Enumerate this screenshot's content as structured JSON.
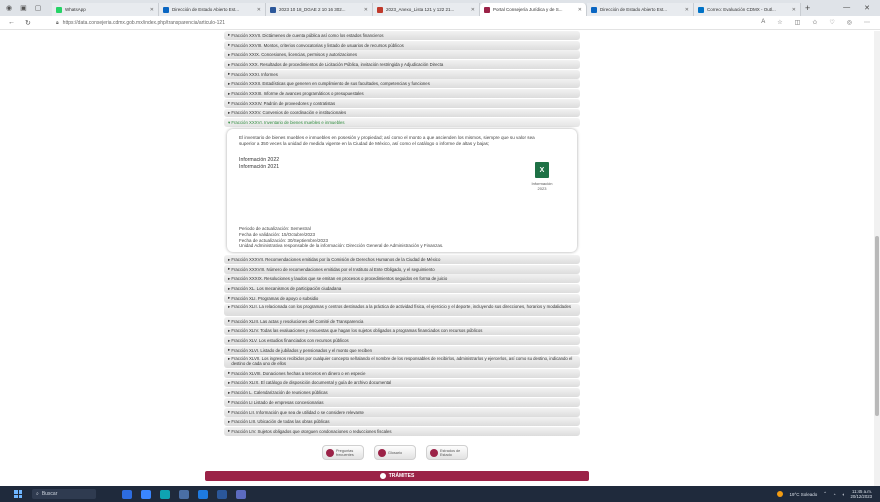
{
  "browser": {
    "tabs": [
      {
        "label": "WhatsApp",
        "color": "#25d366",
        "active": false
      },
      {
        "label": "Dirección de Estado Abierto Est...",
        "color": "#0a66c2",
        "active": false
      },
      {
        "label": "2023 10 18_DGAE 2 10 16 302...",
        "color": "#2b579a",
        "active": false
      },
      {
        "label": "2023_Anexo_Lista 121 y 122 21...",
        "color": "#c0392b",
        "active": false
      },
      {
        "label": "Portal Consejería Jurídica y de S...",
        "color": "#9b2247",
        "active": true
      },
      {
        "label": "Dirección de Estado Abierto Est...",
        "color": "#0a66c2",
        "active": false
      },
      {
        "label": "Correo: Evaluación CDMX - Outl...",
        "color": "#0072c6",
        "active": false
      }
    ],
    "new_tab": "+",
    "url": "https://data.consejeria.cdmx.gob.mx/index.php/transparencia/articulo-121"
  },
  "fractions_top": [
    "Fracción XXVII. Dictámenes de cuenta pública así como los estados financieros",
    "Fracción XXVIII. Montos, criterios convocatorias y listado de usuarios de recursos públicos",
    "Fracción XXIX. Concesiones, licencias, permisos y autorizaciones",
    "Fracción XXX. Resultados de procedimientos de Licitación Pública, invitación restringida y Adjudicación Directa",
    "Fracción XXXI. Informes",
    "Fracción XXXII. Estadísticas que generen en cumplimiento de sus facultades, competencias y funciones",
    "Fracción XXXIII. Informe de avances programáticos o presupuestales",
    "Fracción XXXIV. Padrón de proveedores y contratistas",
    "Fracción XXXV. Convenios de coordinación e institucionales"
  ],
  "open_fraction": {
    "title": "Fracción XXXVI. Inventario de bienes muebles e inmuebles",
    "intro": "El inventario de bienes muebles e inmuebles en posesión y propiedad; así como el monto a que ascienden los mismos, siempre que su valor sea superior a 350 veces la unidad de medida vigente en la Ciudad de México, así como el catálogo o informe de altas y bajas;",
    "info_2022": "Información 2022",
    "info_2021": "Información 2021",
    "excel_caption": "Información 2023",
    "periodo": "Periodo de actualización: Semestral",
    "validacion": "Fecha de validación: 15/Octubre/2023",
    "actualizacion": "Fecha de actualización: 30/Septiembre/2023",
    "unidad": "Unidad Administrativa responsable de la información: Dirección General de Administración y Finanzas."
  },
  "fractions_bottom": [
    {
      "text": "Fracción XXXVII. Recomendaciones emitidas por la Comisión de Derechos Humanos de la Ciudad de México",
      "tall": false
    },
    {
      "text": "Fracción XXXVIII. Número de recomendaciones emitidas por el Instituto al Ente Obligado, y el seguimiento",
      "tall": false
    },
    {
      "text": "Fracción XXXIX. Resoluciones y laudos que se emitan en procesos o procedimientos seguidos en forma de juicio",
      "tall": false
    },
    {
      "text": "Fracción XL. Los mecanismos de participación ciudadana",
      "tall": false
    },
    {
      "text": "Fracción XLI. Programas de apoyo o subsidio",
      "tall": false
    },
    {
      "text": "Fracción XLII. La relacionada con los programas y centros destinados a la práctica de actividad física, el ejercicio y el deporte, incluyendo sus direcciones, horarios y modalidades",
      "tall": true
    },
    {
      "text": "Fracción XLIII. Las actas y resoluciones del Comité de Transparencia",
      "tall": false
    },
    {
      "text": "Fracción XLIV. Todas las evaluaciones y encuestas que hagan los sujetos obligados a programas financiados con recursos públicos",
      "tall": false
    },
    {
      "text": "Fracción XLV. Los estudios financiados con recursos públicos",
      "tall": false
    },
    {
      "text": "Fracción XLVI. Listado de jubilados y pensionados y el monto que reciben",
      "tall": false
    },
    {
      "text": "Fracción XLVII. Los ingresos recibidos por cualquier concepto señalando el nombre de los responsables de recibirlos, administrarlos y ejercerlos, así como su destino, indicando el destino de cada uno de ellos",
      "tall": true
    },
    {
      "text": "Fracción XLVIII. Donaciones hechas a terceros en dinero o en especie",
      "tall": false
    },
    {
      "text": "Fracción XLIX. El catálogo de disposición documental y guía de archivo documental",
      "tall": false
    },
    {
      "text": "Fracción L. Calendarización de reuniones públicas",
      "tall": false
    },
    {
      "text": "Fracción LI Listado de empresas concesionarias",
      "tall": false
    },
    {
      "text": "Fracción LII. Información que sea de utilidad o se considere relevante",
      "tall": false
    },
    {
      "text": "Fracción LIII. Ubicación de todas las obras públicas",
      "tall": false
    },
    {
      "text": "Fracción LIV. Sujetos obligados que otorguen condonaciones o reducciones fiscales",
      "tall": false
    }
  ],
  "footer_buttons": [
    {
      "label": "Preguntas frecuentes",
      "name": "faq-button"
    },
    {
      "label": "Glosario",
      "name": "glossary-button"
    },
    {
      "label": "Estrados de Estado",
      "name": "estrados-button"
    }
  ],
  "tramites_label": "TRÁMITES",
  "taskbar": {
    "search_placeholder": "Buscar",
    "weather": "19°C Soleado",
    "time": "11:45 a.m.",
    "date": "20/12/2023"
  }
}
